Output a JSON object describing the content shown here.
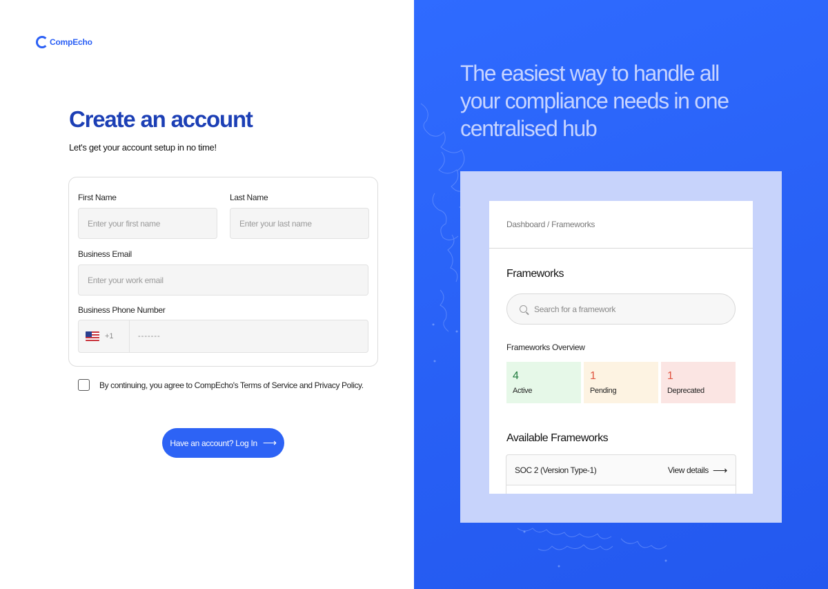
{
  "brand": {
    "name": "CompEcho"
  },
  "signup": {
    "title": "Create an account",
    "subtitle": "Let's get your account setup in no time!",
    "first_name_label": "First Name",
    "first_name_placeholder": "Enter your first name",
    "last_name_label": "Last Name",
    "last_name_placeholder": "Enter your last name",
    "email_label": "Business Email",
    "email_placeholder": "Enter your work email",
    "phone_label": "Business Phone Number",
    "phone_country_code": "+1",
    "phone_placeholder": "-------",
    "terms_text": "By continuing, you agree to CompEcho's  Terms of Service and Privacy Policy.",
    "login_label": "Have an account? Log In",
    "login_icon": "arrow-right-icon"
  },
  "promo": {
    "headline": "The easiest way to handle all your  compliance needs in one centralised hub"
  },
  "preview": {
    "breadcrumb": "Dashboard / Frameworks",
    "title": "Frameworks",
    "search_placeholder": "Search for a framework",
    "overview_title": "Frameworks  Overview",
    "stats": [
      {
        "value": "4",
        "label": "Active",
        "color": "#1f7a3d",
        "bg": "#e6f8e8"
      },
      {
        "value": "1",
        "label": "Pending",
        "color": "#e0533f",
        "bg": "#fdf3e2"
      },
      {
        "value": "1",
        "label": "Deprecated",
        "color": "#e0533f",
        "bg": "#fbe5e3"
      }
    ],
    "available_title": "Available Frameworks",
    "frameworks": [
      {
        "name": "SOC 2 (Version Type-1)",
        "action": "View details"
      }
    ]
  },
  "colors": {
    "accent": "#2d63f5",
    "title": "#1c3fb5",
    "promo_bg": "#2860f5",
    "frame_bg": "#c7d3fb"
  }
}
